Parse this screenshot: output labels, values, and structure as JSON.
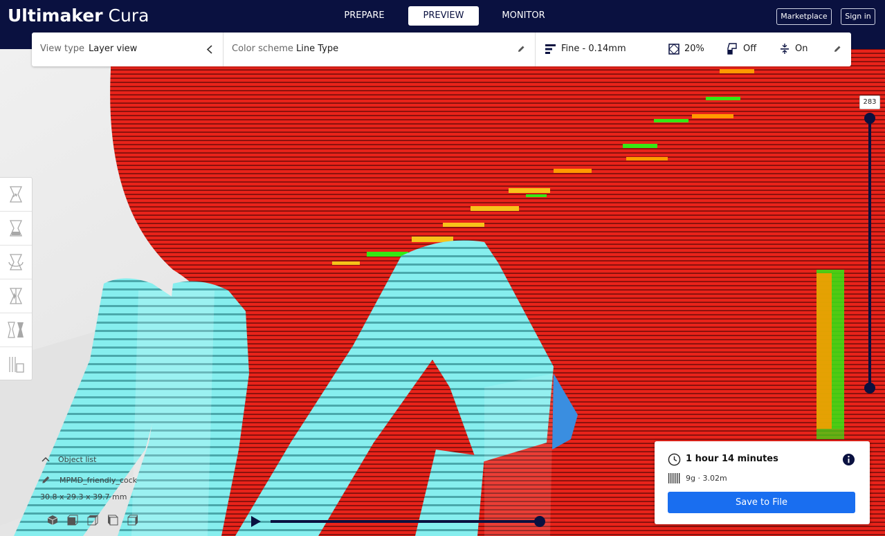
{
  "app": {
    "title_bold": "Ultimaker",
    "title_light": " Cura"
  },
  "stages": [
    {
      "label": "PREPARE"
    },
    {
      "label": "PREVIEW"
    },
    {
      "label": "MONITOR"
    }
  ],
  "header_buttons": {
    "marketplace": "Marketplace",
    "signin": "Sign in"
  },
  "view_type": {
    "label": "View type",
    "value": "Layer view"
  },
  "color_scheme": {
    "label": "Color scheme",
    "value": "Line Type"
  },
  "print_settings": {
    "profile": "Fine - 0.14mm",
    "infill": "20%",
    "support": "Off",
    "adhesion": "On"
  },
  "layer_slider": {
    "current_layer": "283"
  },
  "object_list": {
    "title": "Object list",
    "object_name": "MPMD_friendly_cock",
    "dimensions": "30.8 x 29.3 x 39.7 mm"
  },
  "print_info": {
    "time": "1 hour 14 minutes",
    "material": "9g · 3.02m",
    "save_label": "Save to File"
  },
  "colors": {
    "header_bg": "#0a1140",
    "accent": "#196ef0",
    "wall_outer": "#e8231a",
    "support": "#80ecec",
    "skin": "#f7c31a",
    "infill": "#ff9a00",
    "travel": "#35e814"
  }
}
